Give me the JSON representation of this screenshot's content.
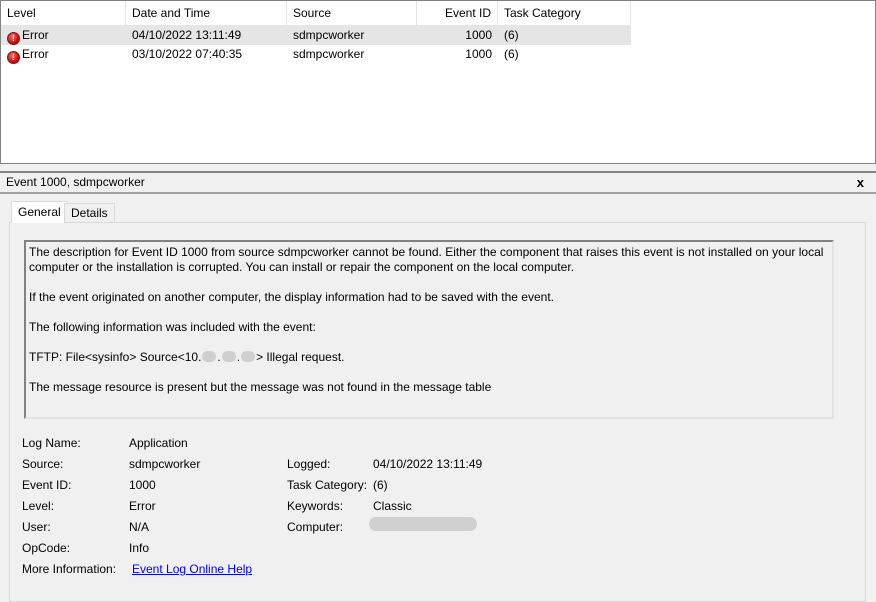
{
  "columns": [
    "Level",
    "Date and Time",
    "Source",
    "Event ID",
    "Task Category"
  ],
  "rows": [
    {
      "level": "Error",
      "date": "04/10/2022 13:11:49",
      "source": "sdmpcworker",
      "event_id": "1000",
      "task": "(6)"
    },
    {
      "level": "Error",
      "date": "03/10/2022 07:40:35",
      "source": "sdmpcworker",
      "event_id": "1000",
      "task": "(6)"
    }
  ],
  "detail": {
    "title": "Event 1000, sdmpcworker",
    "close": "x",
    "tabs": [
      "General",
      "Details"
    ],
    "desc": {
      "p1": "The description for Event ID 1000 from source sdmpcworker cannot be found. Either the component that raises this event is not installed on your local computer or the installation is corrupted. You can install or repair the component on the local computer.",
      "p2": "If the event originated on another computer, the display information had to be saved with the event.",
      "p3": "The following information was included with the event:",
      "p4a": "TFTP: File<sysinfo> Source<10.",
      "p4b": "> Illegal request.",
      "p5": "The message resource is present but the message was not found in the message table"
    },
    "fields": {
      "log_name_label": "Log Name:",
      "log_name": "Application",
      "source_label": "Source:",
      "source": "sdmpcworker",
      "logged_label": "Logged:",
      "logged": "04/10/2022 13:11:49",
      "event_id_label": "Event ID:",
      "event_id": "1000",
      "task_label": "Task Category:",
      "task": "(6)",
      "level_label": "Level:",
      "level": "Error",
      "keywords_label": "Keywords:",
      "keywords": "Classic",
      "user_label": "User:",
      "user": "N/A",
      "computer_label": "Computer:",
      "opcode_label": "OpCode:",
      "opcode": "Info",
      "more_label": "More Information:",
      "more_link": "Event Log Online Help"
    }
  }
}
